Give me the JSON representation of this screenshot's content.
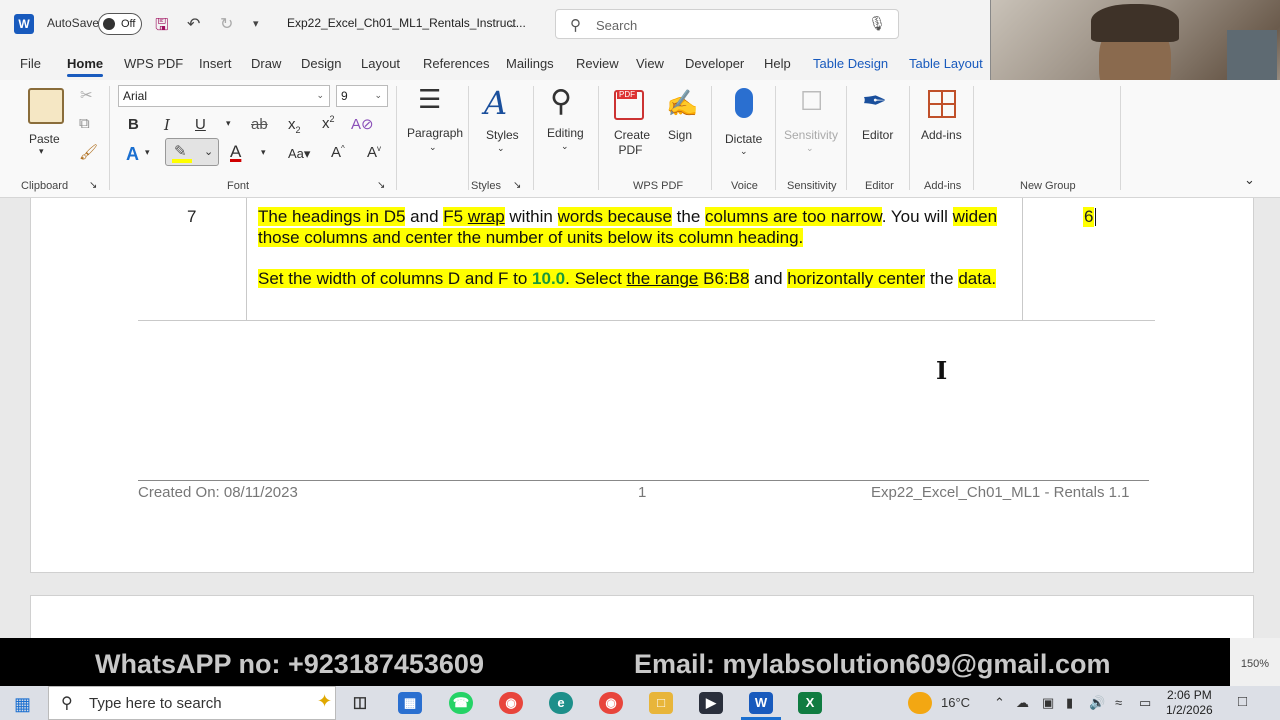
{
  "titlebar": {
    "autosave_label": "AutoSave",
    "autosave_state": "Off",
    "doc_title": "Exp22_Excel_Ch01_ML1_Rentals_Instruct...",
    "search_placeholder": "Search"
  },
  "tabs": [
    "File",
    "Home",
    "WPS PDF",
    "Insert",
    "Draw",
    "Design",
    "Layout",
    "References",
    "Mailings",
    "Review",
    "View",
    "Developer",
    "Help",
    "Table Design",
    "Table Layout"
  ],
  "ribbon": {
    "paste": "Paste",
    "clipboard": "Clipboard",
    "font_name": "Arial",
    "font_size": "9",
    "font_group": "Font",
    "paragraph": "Paragraph",
    "styles": "Styles",
    "styles_group": "Styles",
    "editing": "Editing",
    "create_pdf": "Create PDF",
    "sign": "Sign",
    "wps_group": "WPS PDF",
    "dictate": "Dictate",
    "voice_group": "Voice",
    "sensitivity": "Sensitivity",
    "sensitivity_group": "Sensitivity",
    "editor": "Editor",
    "editor_group": "Editor",
    "addins": "Add-ins",
    "addins_group": "Add-ins",
    "new_group": "New Group"
  },
  "document": {
    "step_number": "7",
    "points": "6",
    "footer_created": "Created On: 08/11/2023",
    "footer_page": "1",
    "footer_title": "Exp22_Excel_Ch01_ML1 - Rentals 1.1"
  },
  "banner": {
    "whatsapp": "WhatsAPP no: +923187453609",
    "email": "Email: mylabsolution609@gmail.com"
  },
  "status": {
    "zoom": "150%"
  },
  "taskbar": {
    "search_placeholder": "Type here to search",
    "temperature": "16°C",
    "time": "2:06 PM",
    "date": "1/2/2026"
  },
  "colors": {
    "accent": "#185abd",
    "highlight": "#ffff00",
    "green_text": "#1a9a3a"
  }
}
